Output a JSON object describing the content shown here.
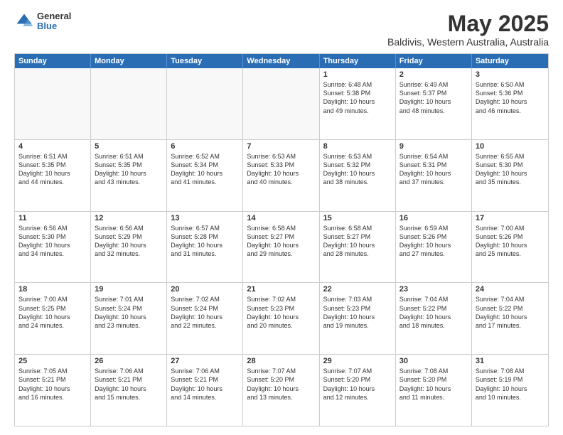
{
  "header": {
    "logo_general": "General",
    "logo_blue": "Blue",
    "title": "May 2025",
    "subtitle": "Baldivis, Western Australia, Australia"
  },
  "calendar": {
    "days": [
      "Sunday",
      "Monday",
      "Tuesday",
      "Wednesday",
      "Thursday",
      "Friday",
      "Saturday"
    ],
    "weeks": [
      [
        {
          "day": "",
          "info": ""
        },
        {
          "day": "",
          "info": ""
        },
        {
          "day": "",
          "info": ""
        },
        {
          "day": "",
          "info": ""
        },
        {
          "day": "1",
          "info": "Sunrise: 6:48 AM\nSunset: 5:38 PM\nDaylight: 10 hours\nand 49 minutes."
        },
        {
          "day": "2",
          "info": "Sunrise: 6:49 AM\nSunset: 5:37 PM\nDaylight: 10 hours\nand 48 minutes."
        },
        {
          "day": "3",
          "info": "Sunrise: 6:50 AM\nSunset: 5:36 PM\nDaylight: 10 hours\nand 46 minutes."
        }
      ],
      [
        {
          "day": "4",
          "info": "Sunrise: 6:51 AM\nSunset: 5:35 PM\nDaylight: 10 hours\nand 44 minutes."
        },
        {
          "day": "5",
          "info": "Sunrise: 6:51 AM\nSunset: 5:35 PM\nDaylight: 10 hours\nand 43 minutes."
        },
        {
          "day": "6",
          "info": "Sunrise: 6:52 AM\nSunset: 5:34 PM\nDaylight: 10 hours\nand 41 minutes."
        },
        {
          "day": "7",
          "info": "Sunrise: 6:53 AM\nSunset: 5:33 PM\nDaylight: 10 hours\nand 40 minutes."
        },
        {
          "day": "8",
          "info": "Sunrise: 6:53 AM\nSunset: 5:32 PM\nDaylight: 10 hours\nand 38 minutes."
        },
        {
          "day": "9",
          "info": "Sunrise: 6:54 AM\nSunset: 5:31 PM\nDaylight: 10 hours\nand 37 minutes."
        },
        {
          "day": "10",
          "info": "Sunrise: 6:55 AM\nSunset: 5:30 PM\nDaylight: 10 hours\nand 35 minutes."
        }
      ],
      [
        {
          "day": "11",
          "info": "Sunrise: 6:56 AM\nSunset: 5:30 PM\nDaylight: 10 hours\nand 34 minutes."
        },
        {
          "day": "12",
          "info": "Sunrise: 6:56 AM\nSunset: 5:29 PM\nDaylight: 10 hours\nand 32 minutes."
        },
        {
          "day": "13",
          "info": "Sunrise: 6:57 AM\nSunset: 5:28 PM\nDaylight: 10 hours\nand 31 minutes."
        },
        {
          "day": "14",
          "info": "Sunrise: 6:58 AM\nSunset: 5:27 PM\nDaylight: 10 hours\nand 29 minutes."
        },
        {
          "day": "15",
          "info": "Sunrise: 6:58 AM\nSunset: 5:27 PM\nDaylight: 10 hours\nand 28 minutes."
        },
        {
          "day": "16",
          "info": "Sunrise: 6:59 AM\nSunset: 5:26 PM\nDaylight: 10 hours\nand 27 minutes."
        },
        {
          "day": "17",
          "info": "Sunrise: 7:00 AM\nSunset: 5:26 PM\nDaylight: 10 hours\nand 25 minutes."
        }
      ],
      [
        {
          "day": "18",
          "info": "Sunrise: 7:00 AM\nSunset: 5:25 PM\nDaylight: 10 hours\nand 24 minutes."
        },
        {
          "day": "19",
          "info": "Sunrise: 7:01 AM\nSunset: 5:24 PM\nDaylight: 10 hours\nand 23 minutes."
        },
        {
          "day": "20",
          "info": "Sunrise: 7:02 AM\nSunset: 5:24 PM\nDaylight: 10 hours\nand 22 minutes."
        },
        {
          "day": "21",
          "info": "Sunrise: 7:02 AM\nSunset: 5:23 PM\nDaylight: 10 hours\nand 20 minutes."
        },
        {
          "day": "22",
          "info": "Sunrise: 7:03 AM\nSunset: 5:23 PM\nDaylight: 10 hours\nand 19 minutes."
        },
        {
          "day": "23",
          "info": "Sunrise: 7:04 AM\nSunset: 5:22 PM\nDaylight: 10 hours\nand 18 minutes."
        },
        {
          "day": "24",
          "info": "Sunrise: 7:04 AM\nSunset: 5:22 PM\nDaylight: 10 hours\nand 17 minutes."
        }
      ],
      [
        {
          "day": "25",
          "info": "Sunrise: 7:05 AM\nSunset: 5:21 PM\nDaylight: 10 hours\nand 16 minutes."
        },
        {
          "day": "26",
          "info": "Sunrise: 7:06 AM\nSunset: 5:21 PM\nDaylight: 10 hours\nand 15 minutes."
        },
        {
          "day": "27",
          "info": "Sunrise: 7:06 AM\nSunset: 5:21 PM\nDaylight: 10 hours\nand 14 minutes."
        },
        {
          "day": "28",
          "info": "Sunrise: 7:07 AM\nSunset: 5:20 PM\nDaylight: 10 hours\nand 13 minutes."
        },
        {
          "day": "29",
          "info": "Sunrise: 7:07 AM\nSunset: 5:20 PM\nDaylight: 10 hours\nand 12 minutes."
        },
        {
          "day": "30",
          "info": "Sunrise: 7:08 AM\nSunset: 5:20 PM\nDaylight: 10 hours\nand 11 minutes."
        },
        {
          "day": "31",
          "info": "Sunrise: 7:08 AM\nSunset: 5:19 PM\nDaylight: 10 hours\nand 10 minutes."
        }
      ]
    ]
  }
}
